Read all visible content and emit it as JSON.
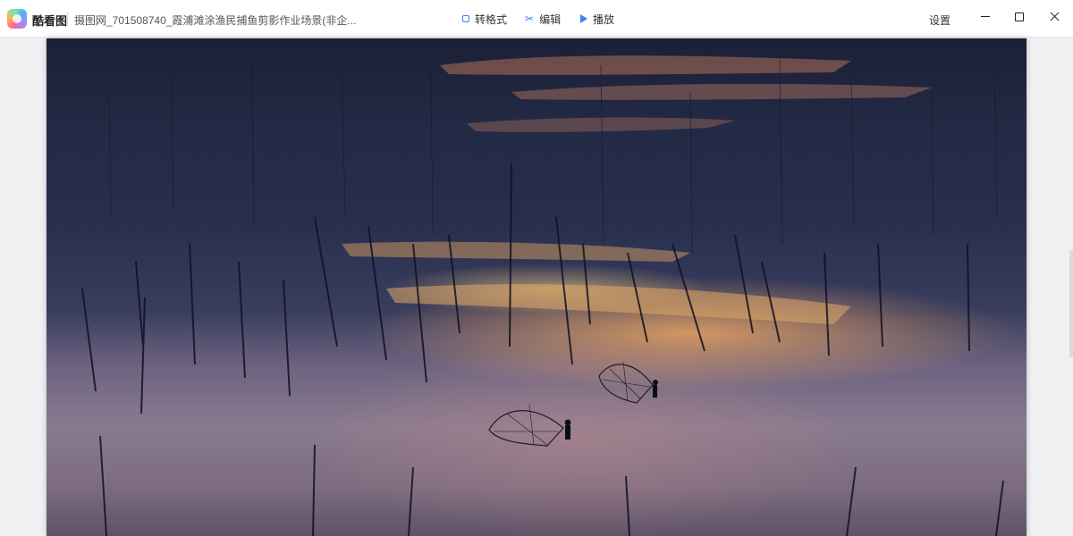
{
  "app": {
    "name": "酷看图",
    "file_name": "摄图网_701508740_霞浦滩涂渔民捕鱼剪影作业场景(非企..."
  },
  "toolbar": {
    "convert_label": "转格式",
    "edit_label": "编辑",
    "play_label": "播放",
    "settings_label": "设置"
  },
  "icons": {
    "logo": "app-logo-icon",
    "convert": "convert-icon",
    "edit": "scissors-icon",
    "play": "play-icon",
    "minimize": "minimize-icon",
    "maximize": "maximize-icon",
    "close": "close-icon"
  },
  "colors": {
    "accent": "#3b82f6",
    "titlebar_bg": "#ffffff",
    "viewer_bg": "#f1f1f3"
  }
}
